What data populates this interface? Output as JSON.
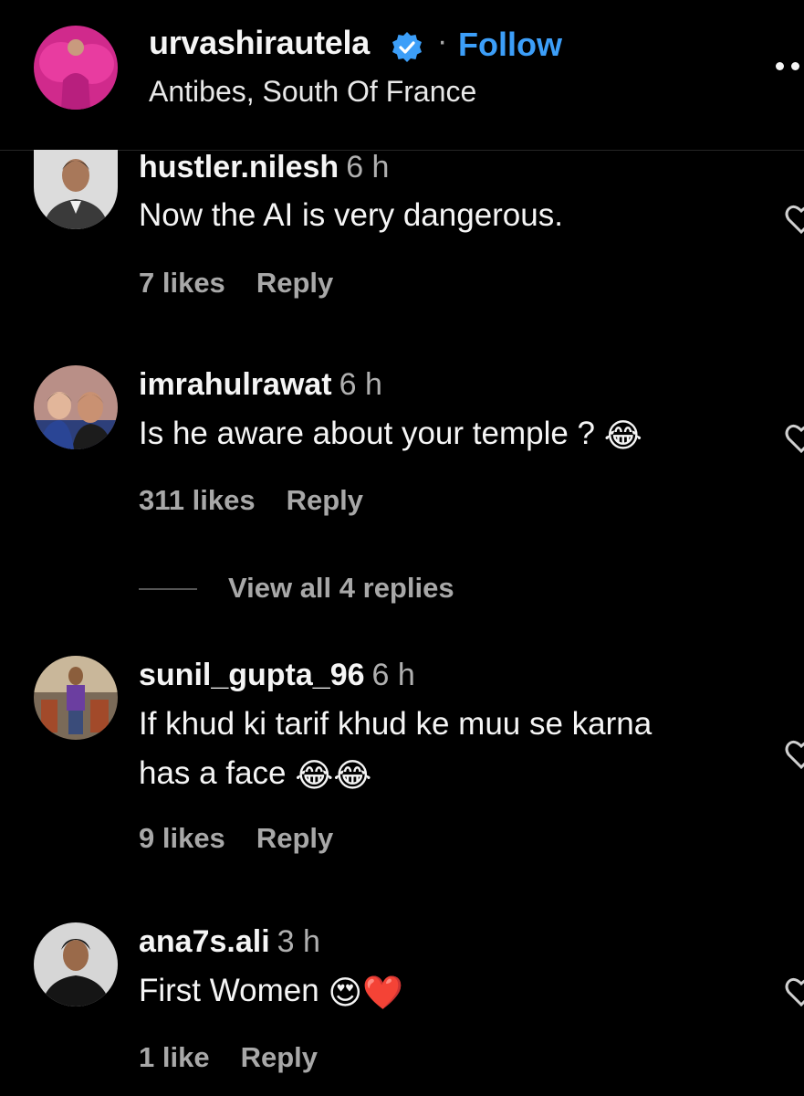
{
  "header": {
    "username": "urvashirautela",
    "separator": "·",
    "follow_label": "Follow",
    "location": "Antibes, South Of France"
  },
  "comments": [
    {
      "username": "hustler.nilesh",
      "time": "6 h",
      "text": "Now the AI is very dangerous.",
      "likes": "7 likes",
      "reply_label": "Reply"
    },
    {
      "username": "imrahulrawat",
      "time": "6 h",
      "text": "Is he aware about your temple ?",
      "emoji": "😂",
      "likes": "311 likes",
      "reply_label": "Reply"
    },
    {
      "username": "sunil_gupta_96",
      "time": "6 h",
      "text_line1": "If khud ki tarif khud ke muu se karna",
      "text_line2": "has a face",
      "emoji": "😂😂",
      "likes": "9 likes",
      "reply_label": "Reply"
    },
    {
      "username": "ana7s.ali",
      "time": "3 h",
      "text": "First Women",
      "emoji": "😍❤️",
      "likes": "1 like",
      "reply_label": "Reply"
    }
  ],
  "view_replies_label": "View all 4 replies",
  "icons": {
    "verified": "verified-badge-icon",
    "more": "more-options-icon",
    "like": "heart-outline-icon"
  },
  "colors": {
    "background": "#000000",
    "accent": "#3c9ef8",
    "muted": "#a8a8a8"
  }
}
